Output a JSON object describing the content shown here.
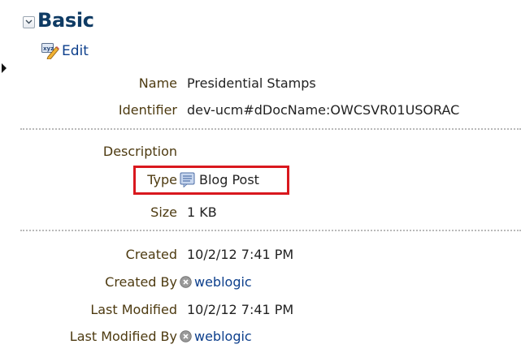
{
  "section": {
    "title": "Basic",
    "edit_label": "Edit"
  },
  "fields": {
    "name": {
      "label": "Name",
      "value": "Presidential Stamps"
    },
    "identifier": {
      "label": "Identifier",
      "value": "dev-ucm#dDocName:OWCSVR01USORAC"
    },
    "description": {
      "label": "Description",
      "value": ""
    },
    "type": {
      "label": "Type",
      "value": "Blog Post",
      "icon": "blog-post-icon"
    },
    "size": {
      "label": "Size",
      "value": "1 KB"
    },
    "created": {
      "label": "Created",
      "value": "10/2/12 7:41 PM"
    },
    "created_by": {
      "label": "Created By",
      "value": "weblogic",
      "icon": "user-icon"
    },
    "last_modified": {
      "label": "Last Modified",
      "value": "10/2/12 7:41 PM"
    },
    "last_modified_by": {
      "label": "Last Modified By",
      "value": "weblogic",
      "icon": "user-icon"
    }
  },
  "colors": {
    "highlight": "#d9181e",
    "title": "#0f3b64",
    "link": "#0d3f8c",
    "label": "#4d3a10"
  }
}
